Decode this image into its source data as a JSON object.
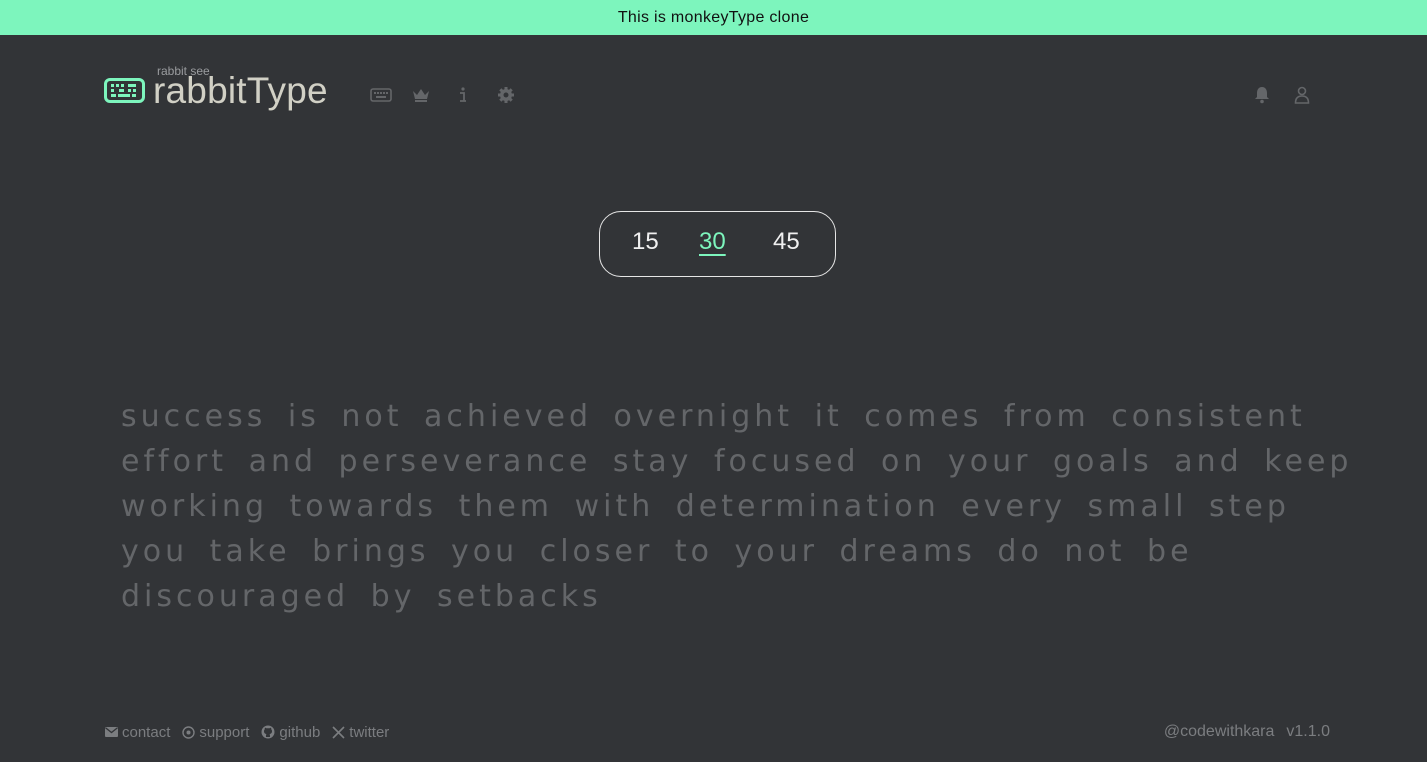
{
  "banner": {
    "text": "This is monkeyType clone"
  },
  "logo": {
    "subtitle": "rabbit see",
    "title": "rabbitType"
  },
  "nav": {
    "icons": [
      "keyboard-icon",
      "crown-icon",
      "info-icon",
      "gear-icon"
    ],
    "right_icons": [
      "bell-icon",
      "user-icon"
    ]
  },
  "time_options": {
    "items": [
      "15",
      "30",
      "45"
    ],
    "selected": "30"
  },
  "typing_text": {
    "lines": [
      "success is not achieved overnight it comes from consistent",
      "effort and perseverance stay focused on your goals and keep",
      "working towards them with determination every small step",
      "you take brings you closer to your dreams do not be",
      "discouraged by setbacks"
    ]
  },
  "footer": {
    "links": [
      {
        "icon": "mail-icon",
        "label": "contact"
      },
      {
        "icon": "support-icon",
        "label": "support"
      },
      {
        "icon": "github-icon",
        "label": "github"
      },
      {
        "icon": "x-icon",
        "label": "twitter"
      }
    ],
    "handle": "@codewithkara",
    "version": "v1.1.0"
  },
  "colors": {
    "background": "#323437",
    "accent": "#7df5bd",
    "text_dim": "#646669",
    "text_main": "#d1d0c5"
  }
}
